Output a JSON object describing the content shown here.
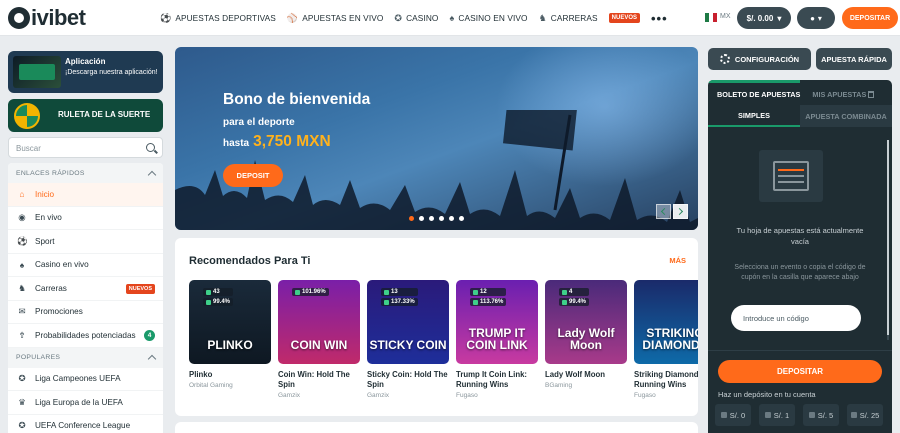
{
  "header": {
    "logo": "ivibet",
    "nav": [
      {
        "label": "APUESTAS DEPORTIVAS",
        "icon": "soccer-ball-icon",
        "glyph": "⚽"
      },
      {
        "label": "APUESTAS EN VIVO",
        "icon": "live-bet-icon",
        "glyph": "⚾"
      },
      {
        "label": "CASINO",
        "icon": "casino-chip-icon",
        "glyph": "✪"
      },
      {
        "label": "CASINO EN VIVO",
        "icon": "live-casino-icon",
        "glyph": "♠"
      },
      {
        "label": "CARRERAS",
        "icon": "horse-icon",
        "glyph": "♞"
      }
    ],
    "new_badge": "NUEVOS",
    "more": "•••",
    "locale": "MX",
    "balance": "$/. 0.00",
    "deposit": "DEPOSITAR"
  },
  "sidebar": {
    "app_title": "Aplicación",
    "app_sub": "¡Descarga nuestra aplicación!",
    "roulette": "RULETA DE LA SUERTE",
    "search_placeholder": "Buscar",
    "quick_links_title": "ENLACES RÁPIDOS",
    "items": [
      {
        "label": "Inicio",
        "glyph": "⌂",
        "active": true
      },
      {
        "label": "En vivo",
        "glyph": "◉"
      },
      {
        "label": "Sport",
        "glyph": "⚽"
      },
      {
        "label": "Casino en vivo",
        "glyph": "♠"
      },
      {
        "label": "Carreras",
        "glyph": "♞",
        "badge": "NUEVOS"
      },
      {
        "label": "Promociones",
        "glyph": "✉"
      },
      {
        "label": "Probabilidades potenciadas",
        "glyph": "⇮",
        "count": "4"
      }
    ],
    "popular_title": "POPULARES",
    "popular": [
      {
        "label": "Liga Campeones UEFA",
        "glyph": "✪"
      },
      {
        "label": "Liga Europa de la UEFA",
        "glyph": "♛"
      },
      {
        "label": "UEFA Conference League",
        "glyph": "✪"
      }
    ]
  },
  "banner": {
    "title": "Bono de bienvenida",
    "sub": "para el deporte",
    "amount_prefix": "hasta",
    "amount": "3,750 MXN",
    "button": "DEPOSIT",
    "slides": 6,
    "active_slide": 0
  },
  "recommended": {
    "title": "Recomendados Para Ti",
    "more": "MÁS",
    "games": [
      {
        "name": "Plinko",
        "provider": "Orbital Gaming",
        "art": "PLINKO",
        "chip1": "43",
        "chip2": "99.4%",
        "bg": "linear-gradient(180deg,#1a2a3a,#0e1822)"
      },
      {
        "name": "Coin Win: Hold The Spin",
        "provider": "Gamzix",
        "art": "COIN WIN",
        "chip1": "101.96%",
        "chip2": "",
        "bg": "linear-gradient(180deg,#7a1fa8,#c02a6a)"
      },
      {
        "name": "Sticky Coin: Hold The Spin",
        "provider": "Gamzix",
        "art": "STICKY COIN",
        "chip1": "13",
        "chip2": "137.33%",
        "bg": "linear-gradient(180deg,#2a1a7a,#1e2e9a)"
      },
      {
        "name": "Trump It Coin Link: Running Wins",
        "provider": "Fugaso",
        "art": "TRUMP IT COIN LINK",
        "chip1": "12",
        "chip2": "113.76%",
        "bg": "linear-gradient(180deg,#6a1fb0,#c83aa0)"
      },
      {
        "name": "Lady Wolf Moon",
        "provider": "BGaming",
        "art": "Lady Wolf Moon",
        "chip1": "4",
        "chip2": "99.4%",
        "bg": "linear-gradient(180deg,#4a2a7a,#a83a8a)"
      },
      {
        "name": "Striking Diamonds: Running Wins",
        "provider": "Fugaso",
        "art": "STRIKING DIAMONDS",
        "chip1": "",
        "chip2": "",
        "bg": "linear-gradient(180deg,#1a2a6a,#0e6aa8)"
      }
    ]
  },
  "betslip": {
    "config": "CONFIGURACIÓN",
    "quick_bet": "APUESTA RÁPIDA",
    "tab_slip": "BOLETO DE APUESTAS",
    "tab_my_bets": "MIS APUESTAS",
    "sub_simple": "SIMPLES",
    "sub_combo": "APUESTA COMBINADA",
    "empty_title": "Tu hoja de apuestas está actualmente vacía",
    "empty_text": "Selecciona un evento o copia el código de cupón en la casilla que aparece abajo",
    "coupon_placeholder": "Introduce un código",
    "deposit": "DEPOSITAR",
    "hint": "Haz un depósito en tu cuenta",
    "amounts": [
      "S/. 0",
      "S/. 1",
      "S/. 5",
      "S/. 25"
    ]
  },
  "colors": {
    "accent": "#ff6a1a",
    "dark": "#1f2d33",
    "green": "#1a9a6a"
  }
}
